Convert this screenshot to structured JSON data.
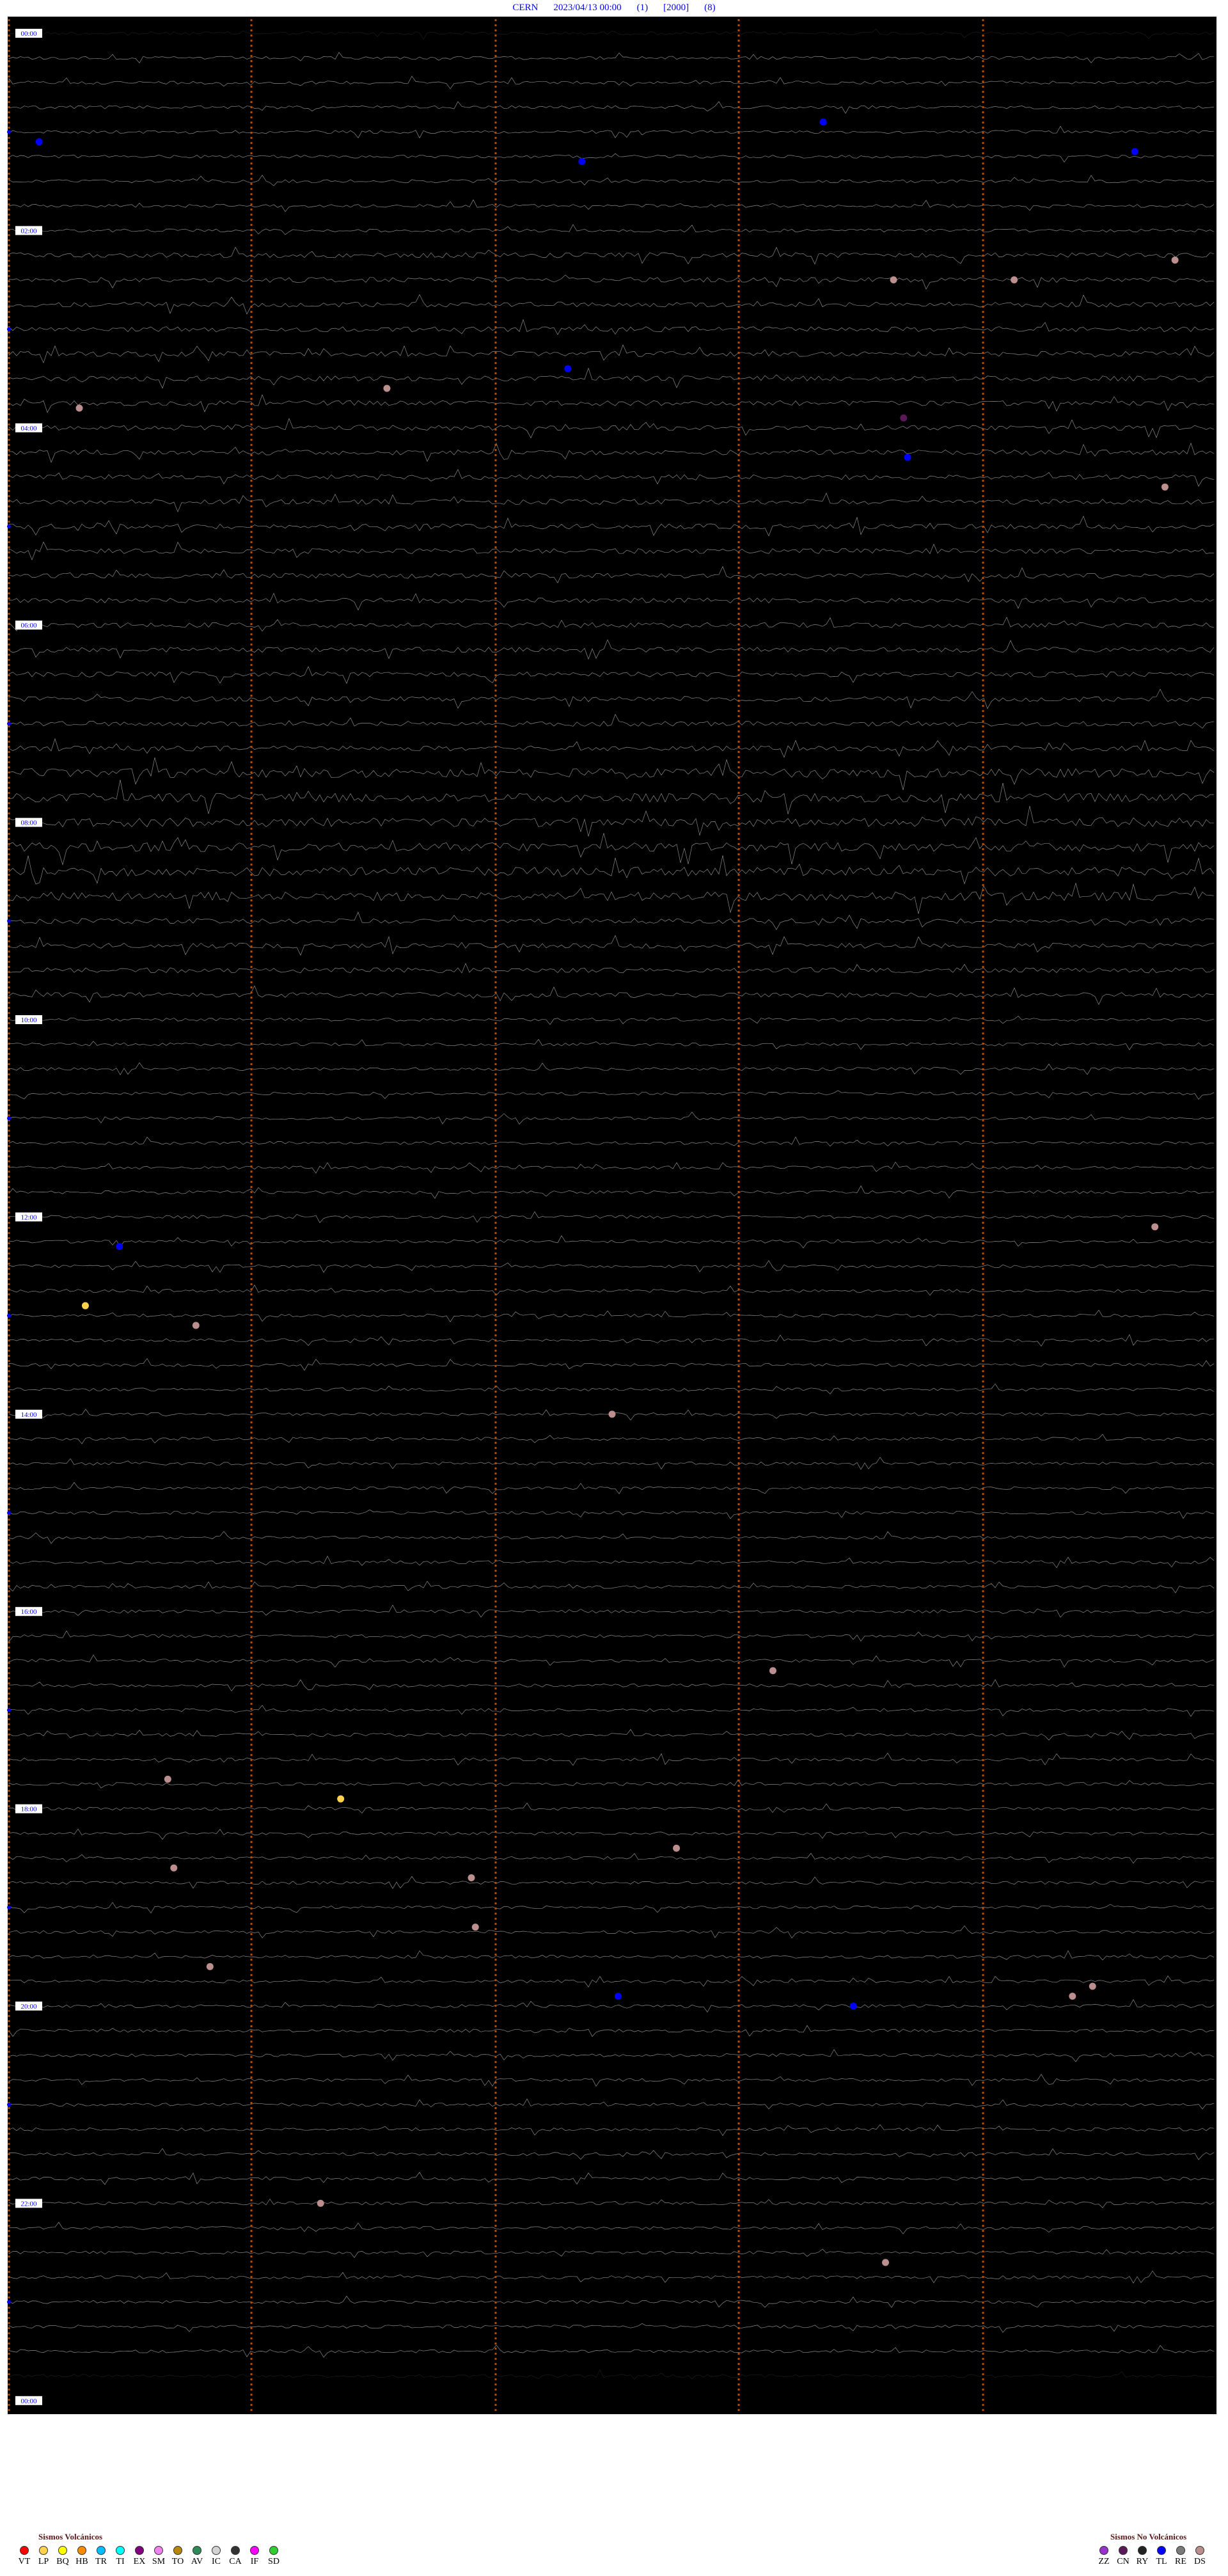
{
  "header": {
    "station": "CERN",
    "datetime": "2023/04/13 00:00",
    "channel": "(1)",
    "gain": "[2000]",
    "flag": "(8)"
  },
  "chart_data": {
    "type": "helicorder",
    "time_labels": [
      "00:00",
      "02:00",
      "04:00",
      "06:00",
      "08:00",
      "10:00",
      "12:00",
      "14:00",
      "16:00",
      "18:00",
      "20:00",
      "22:00",
      "00:00"
    ],
    "trace_color": "#ffffff",
    "background": "#000000",
    "label_color": "#0000ff",
    "minute_marker_color": "#b0500a",
    "events": [
      {
        "type": "TL",
        "hour": 1.1,
        "minute": 1.5
      },
      {
        "type": "TL",
        "hour": 0.9,
        "minute": 40.5
      },
      {
        "type": "TL",
        "hour": 1.3,
        "minute": 28.5
      },
      {
        "type": "TL",
        "hour": 1.2,
        "minute": 56.0
      },
      {
        "type": "DS",
        "hour": 2.3,
        "minute": 58.0
      },
      {
        "type": "DS",
        "hour": 2.5,
        "minute": 44.0
      },
      {
        "type": "DS",
        "hour": 2.5,
        "minute": 50.0
      },
      {
        "type": "TL",
        "hour": 3.4,
        "minute": 27.8
      },
      {
        "type": "DS",
        "hour": 3.8,
        "minute": 3.5
      },
      {
        "type": "DS",
        "hour": 3.6,
        "minute": 18.8
      },
      {
        "type": "CN",
        "hour": 3.9,
        "minute": 44.5
      },
      {
        "type": "TL",
        "hour": 4.3,
        "minute": 44.7
      },
      {
        "type": "DS",
        "hour": 4.6,
        "minute": 57.5
      },
      {
        "type": "TL",
        "hour": 12.3,
        "minute": 5.5
      },
      {
        "type": "LP",
        "hour": 12.9,
        "minute": 3.8
      },
      {
        "type": "DS",
        "hour": 13.1,
        "minute": 9.3
      },
      {
        "type": "DS",
        "hour": 12.1,
        "minute": 57.0
      },
      {
        "type": "DS",
        "hour": 14.0,
        "minute": 30.0
      },
      {
        "type": "DS",
        "hour": 16.6,
        "minute": 38.0
      },
      {
        "type": "LP",
        "hour": 17.9,
        "minute": 16.5
      },
      {
        "type": "DS",
        "hour": 17.7,
        "minute": 7.9
      },
      {
        "type": "DS",
        "hour": 18.6,
        "minute": 8.2
      },
      {
        "type": "DS",
        "hour": 18.7,
        "minute": 23.0
      },
      {
        "type": "DS",
        "hour": 18.4,
        "minute": 33.2
      },
      {
        "type": "DS",
        "hour": 19.2,
        "minute": 23.2
      },
      {
        "type": "DS",
        "hour": 19.6,
        "minute": 10.0
      },
      {
        "type": "TL",
        "hour": 20.0,
        "minute": 42.0
      },
      {
        "type": "TL",
        "hour": 19.9,
        "minute": 30.3
      },
      {
        "type": "DS",
        "hour": 19.8,
        "minute": 53.9
      },
      {
        "type": "DS",
        "hour": 19.9,
        "minute": 52.9
      },
      {
        "type": "DS",
        "hour": 22.0,
        "minute": 15.5
      },
      {
        "type": "DS",
        "hour": 22.6,
        "minute": 43.6
      }
    ]
  },
  "legend_volcanic": {
    "title": "Sismos Volcánicos",
    "items": [
      {
        "code": "VT",
        "color": "#ff0000"
      },
      {
        "code": "LP",
        "color": "#ffd24d"
      },
      {
        "code": "BQ",
        "color": "#ffff00"
      },
      {
        "code": "HB",
        "color": "#ff8c00"
      },
      {
        "code": "TR",
        "color": "#00bfff"
      },
      {
        "code": "TI",
        "color": "#00ffff"
      },
      {
        "code": "EX",
        "color": "#800080"
      },
      {
        "code": "SM",
        "color": "#ee82ee"
      },
      {
        "code": "TO",
        "color": "#b8860b"
      },
      {
        "code": "AV",
        "color": "#2e8b57"
      },
      {
        "code": "IC",
        "color": "#d3d3d3"
      },
      {
        "code": "CA",
        "color": "#333333"
      },
      {
        "code": "IF",
        "color": "#ff00ff"
      },
      {
        "code": "SD",
        "color": "#32cd32"
      }
    ]
  },
  "legend_nonvolcanic": {
    "title": "Sismos No Volcánicos",
    "items": [
      {
        "code": "ZZ",
        "color": "#9932cc"
      },
      {
        "code": "CN",
        "color": "#5a1a5a"
      },
      {
        "code": "RY",
        "color": "#222222"
      },
      {
        "code": "TL",
        "color": "#0000ff"
      },
      {
        "code": "RE",
        "color": "#7a7a7a"
      },
      {
        "code": "DS",
        "color": "#bc8f8f"
      }
    ]
  }
}
